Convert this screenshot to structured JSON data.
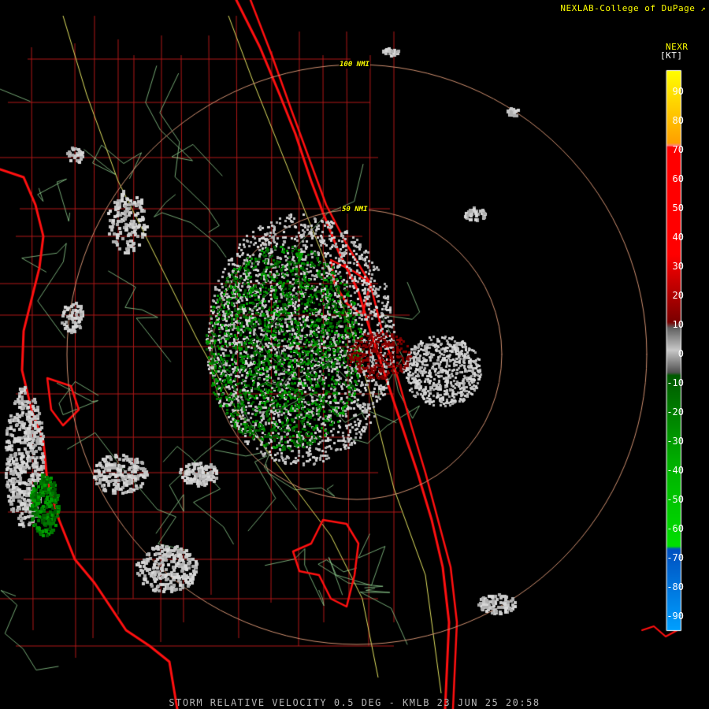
{
  "header": {
    "credit": "NEXLAB-College of DuPage",
    "product": "NEXR",
    "unit": "[KT]"
  },
  "footer": {
    "caption": "STORM RELATIVE VELOCITY 0.5 DEG - KMLB 23 JUN 25 20:58"
  },
  "range_rings": [
    "50 NMI",
    "100 NMI"
  ],
  "legend": {
    "ticks": [
      "90",
      "80",
      "70",
      "60",
      "50",
      "40",
      "30",
      "20",
      "10",
      "0",
      "-10",
      "-20",
      "-30",
      "-40",
      "-50",
      "-60",
      "-70",
      "-80",
      "-90"
    ],
    "colors": {
      "positive_high": "#ffff00",
      "positive_mid": "#ff0000",
      "positive_low": "#7a0000",
      "near_zero": "#c8c8c8",
      "negative_low": "#005a00",
      "negative_mid": "#00e000",
      "negative_high": "#0050c0"
    }
  },
  "map_colors": {
    "coast": "#ff1010",
    "county": "#b01818",
    "road": "#90d090",
    "highway": "#e0e060",
    "ring": "#d09070"
  }
}
